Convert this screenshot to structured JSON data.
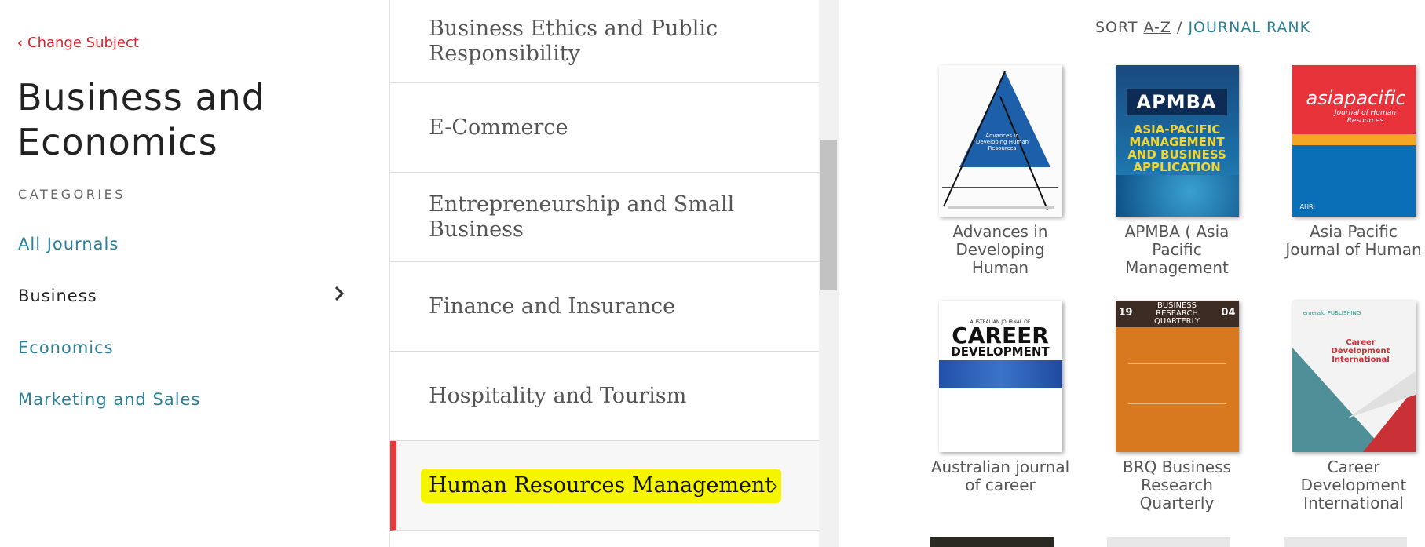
{
  "left": {
    "change_subject": "Change Subject",
    "subject_title": "Business and Economics",
    "categories_label": "CATEGORIES",
    "categories": [
      {
        "label": "All Journals"
      },
      {
        "label": "Business"
      },
      {
        "label": "Economics"
      },
      {
        "label": "Marketing and Sales"
      }
    ]
  },
  "middle": {
    "subcategories": [
      {
        "label": "Business Ethics and Public Responsibility"
      },
      {
        "label": "E-Commerce"
      },
      {
        "label": "Entrepreneurship and Small Business"
      },
      {
        "label": "Finance and Insurance"
      },
      {
        "label": "Hospitality and Tourism"
      },
      {
        "label": "Human Resources Management"
      }
    ]
  },
  "right": {
    "sort_label": "SORT",
    "sort_az": "A-Z",
    "sort_sep": "/",
    "sort_rank": "JOURNAL RANK",
    "journals": [
      {
        "title": "Advances in Developing Human",
        "cover": {
          "sub": "Advances in Developing Human Resources"
        }
      },
      {
        "title": "APMBA ( Asia Pacific Management",
        "cover": {
          "logo": "APMBA",
          "headline": "ASIA-PACIFIC MANAGEMENT AND BUSINESS APPLICATION"
        }
      },
      {
        "title": "Asia Pacific Journal of Human",
        "cover": {
          "logo": "asiapacific",
          "sub": "Journal of Human Resources",
          "badge": "AHRI"
        }
      },
      {
        "title": "Australian journal of career",
        "cover": {
          "pre": "AUSTRALIAN JOURNAL OF",
          "big1": "CAREER",
          "big2": "DEVELOPMENT"
        }
      },
      {
        "title": "BRQ Business Research Quarterly",
        "cover": {
          "left_num": "19",
          "right_num": "04",
          "headline": "BUSINESS RESEARCH QUARTERLY"
        }
      },
      {
        "title": "Career Development International",
        "cover": {
          "brand": "emerald PUBLISHING",
          "headline": "Career Development International"
        }
      }
    ]
  },
  "colors": {
    "accent_red": "#e8393f",
    "link_teal": "#2a7f99",
    "highlight": "#f6f500"
  }
}
